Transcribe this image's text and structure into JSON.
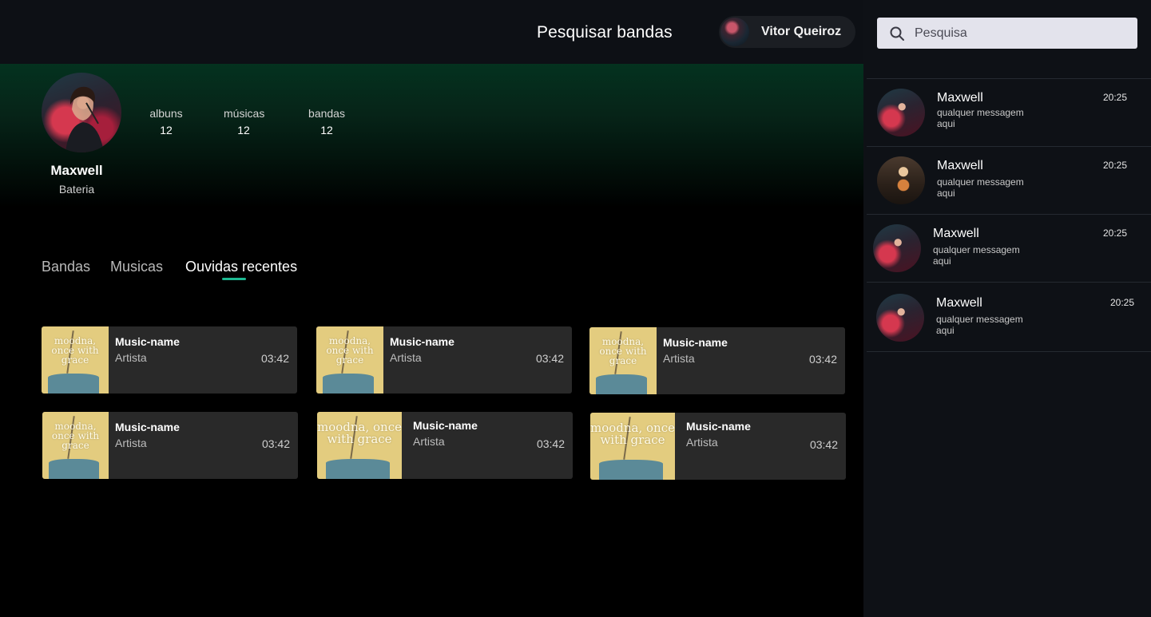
{
  "header": {
    "title": "Pesquisar bandas",
    "user_name": "Vitor Queiroz"
  },
  "search": {
    "placeholder": "Pesquisa"
  },
  "profile": {
    "name": "Maxwell",
    "role": "Bateria",
    "stats": [
      {
        "label": "albuns",
        "value": "12"
      },
      {
        "label": "músicas",
        "value": "12"
      },
      {
        "label": "bandas",
        "value": "12"
      }
    ]
  },
  "tabs": [
    {
      "label": "Bandas",
      "active": false
    },
    {
      "label": "Musicas",
      "active": false
    },
    {
      "label": "Ouvidas recentes",
      "active": true
    }
  ],
  "tracks": [
    {
      "title": "Music-name",
      "artist": "Artista",
      "duration": "03:42",
      "cover_text": "moodna, once with grace"
    },
    {
      "title": "Music-name",
      "artist": "Artista",
      "duration": "03:42",
      "cover_text": "moodna, once with grace"
    },
    {
      "title": "Music-name",
      "artist": "Artista",
      "duration": "03:42",
      "cover_text": "moodna, once with grace"
    },
    {
      "title": "Music-name",
      "artist": "Artista",
      "duration": "03:42",
      "cover_text": "moodna, once with grace"
    },
    {
      "title": "Music-name",
      "artist": "Artista",
      "duration": "03:42",
      "cover_text": "moodna, once with grace"
    },
    {
      "title": "Music-name",
      "artist": "Artista",
      "duration": "03:42",
      "cover_text": "moodna, once with grace"
    }
  ],
  "messages": [
    {
      "name": "Maxwell",
      "text": "qualquer messagem aqui",
      "time": "20:25"
    },
    {
      "name": "Maxwell",
      "text": "qualquer messagem aqui",
      "time": "20:25"
    },
    {
      "name": "Maxwell",
      "text": "qualquer messagem aqui",
      "time": "20:25"
    },
    {
      "name": "Maxwell",
      "text": "qualquer messagem aqui",
      "time": "20:25"
    }
  ],
  "colors": {
    "accent": "#1db992",
    "background": "#000000",
    "card": "#292929",
    "sidebar": "#0e1116"
  }
}
